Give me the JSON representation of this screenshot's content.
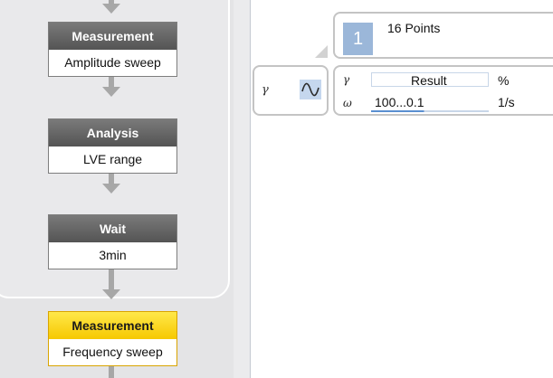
{
  "workflow": {
    "steps": [
      {
        "title": "Measurement",
        "subtitle": "Amplitude sweep",
        "active": false
      },
      {
        "title": "Analysis",
        "subtitle": "LVE range",
        "active": false
      },
      {
        "title": "Wait",
        "subtitle": "3min",
        "active": false
      },
      {
        "title": "Measurement",
        "subtitle": "Frequency sweep",
        "active": true
      }
    ]
  },
  "points": {
    "badge": "1",
    "label": "16 Points"
  },
  "parameter": {
    "symbol": "γ",
    "icon": "sine-wave-icon"
  },
  "result_table": {
    "rows": [
      {
        "symbol": "γ",
        "value": "Result",
        "unit": "%"
      },
      {
        "symbol": "ω",
        "value": "100...0.1",
        "unit": "1/s"
      }
    ]
  },
  "colors": {
    "active_step": "#f6c800",
    "step_header": "#545454",
    "badge": "#9bb7d9",
    "accent_blue": "#5a8fd0"
  }
}
